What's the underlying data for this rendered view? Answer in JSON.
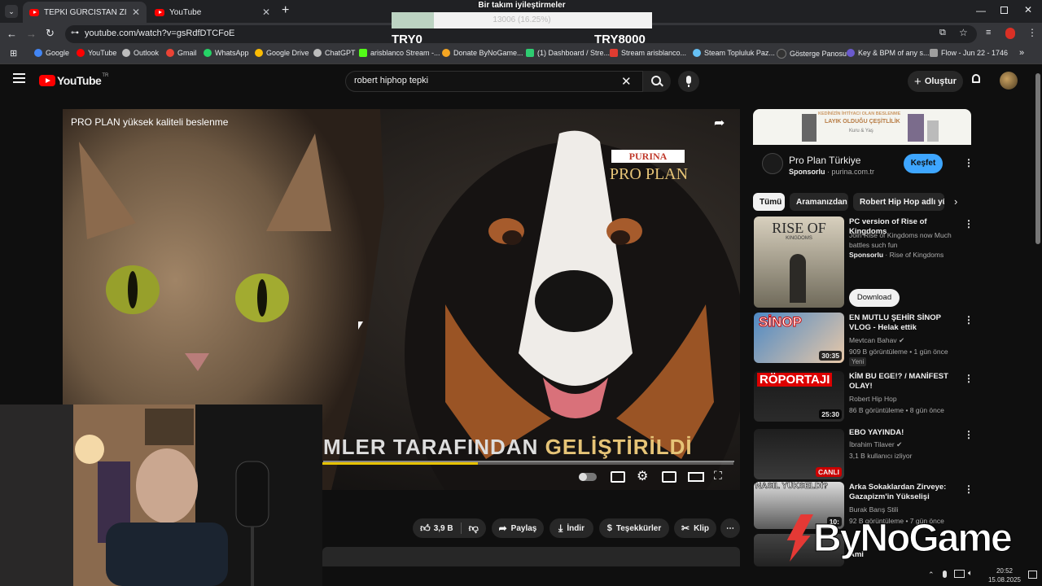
{
  "browser": {
    "tabs": [
      {
        "title": "TEPKİ GÜRCİSTAN ZİYARETİ (yü",
        "active": true
      },
      {
        "title": "YouTube",
        "active": false
      }
    ],
    "new_tab": "+",
    "url": "youtube.com/watch?v=gsRdfDTCFoE",
    "bookmarks": [
      {
        "label": "Google",
        "color": "#4285f4"
      },
      {
        "label": "YouTube",
        "color": "#ff0000"
      },
      {
        "label": "Outlook",
        "color": "#bdbdbd"
      },
      {
        "label": "Gmail",
        "color": "#ea4335"
      },
      {
        "label": "WhatsApp",
        "color": "#25d366"
      },
      {
        "label": "Google Drive",
        "color": "#fbbc04"
      },
      {
        "label": "ChatGPT",
        "color": "#bdbdbd"
      },
      {
        "label": "arisblanco Stream -...",
        "color": "#53fc18"
      },
      {
        "label": "Donate ByNoGame...",
        "color": "#f5a623"
      },
      {
        "label": "(1) Dashboard / Stre...",
        "color": "#2ecc71"
      },
      {
        "label": "Stream arisblanco...",
        "color": "#e03c31"
      },
      {
        "label": "Steam Topluluk Paz...",
        "color": "#66c0f4"
      },
      {
        "label": "Gösterge Panosu",
        "color": "#333333"
      },
      {
        "label": "Key & BPM of any s...",
        "color": "#6a5acd"
      },
      {
        "label": "Flow - Jun 22 - 1746",
        "color": "#9e9e9e"
      }
    ]
  },
  "donation_overlay": {
    "title": "Bir takım iyileştirmeler",
    "progress_text": "13006 (16.25%)",
    "progress_fraction": 0.1625,
    "min_label": "TRY0",
    "max_label": "TRY8000"
  },
  "youtube": {
    "logo": "YouTube",
    "logo_country": "TR",
    "search_query": "robert hiphop tepki",
    "create_label": "Oluştur"
  },
  "player": {
    "ad_title": "PRO PLAN yüksek kaliteli beslenme",
    "brand_top": "PURINA",
    "brand_main": "PRO PLAN",
    "caption_white": "MLER TARAFINDAN ",
    "caption_gold": "GELİŞTİRİLDİ"
  },
  "actions": {
    "likes": "3,9 B",
    "share": "Paylaş",
    "download": "İndir",
    "thanks": "Teşekkürler",
    "clip": "Klip",
    "more": "⋯"
  },
  "sidebar": {
    "ad": {
      "banner_text_1": "KEDİNİZİN İHTİYACI OLAN BESLENME",
      "banner_text_2": "LAYIK OLDUĞU ÇEŞİTLİLİK",
      "banner_text_3": "Kuru & Yaş",
      "advertiser": "Pro Plan Türkiye",
      "sponsored": "Sponsorlu",
      "domain": "purina.com.tr",
      "cta": "Keşfet"
    },
    "chips": [
      "Tümü",
      "Aramanızdan",
      "Robert Hip Hop adlı yük"
    ],
    "sponsored_video": {
      "thumb_title": "RISE OF",
      "thumb_sub": "KINGDOMS",
      "title": "PC version of Rise of Kingdoms",
      "desc": "Join Rise of Kingdoms now Much battles such fun",
      "sponsored": "Sponsorlu",
      "channel": "Rise of Kingdoms",
      "cta": "Download"
    },
    "videos": [
      {
        "title": "EN MUTLU ŞEHİR SİNOP VLOG - Helak ettik",
        "channel": "Mevtcan Bahav",
        "meta": "909 B görüntüleme • 1 gün önce",
        "badge": "Yeni",
        "duration": "30:35",
        "thumb_text": "SİNOP"
      },
      {
        "title": "KİM BU EGE!? / MANİFEST OLAY!",
        "channel": "Robert Hip Hop",
        "meta": "86 B görüntüleme • 8 gün önce",
        "badge": "",
        "duration": "25:30",
        "thumb_text": "RÖPORTAJI"
      },
      {
        "title": "EBO YAYINDA!",
        "channel": "İbrahim Tilaver",
        "meta": "3,1 B kullanıcı izliyor",
        "badge": "",
        "duration": "CANLI",
        "thumb_text": ""
      },
      {
        "title": "Arka Sokaklardan Zirveye: Gazapizm'in Yükselişi",
        "channel": "Burak Barış Stili",
        "meta": "92 B görüntüleme • 7 gün önce",
        "badge": "",
        "duration": "10:",
        "thumb_text": "NASIL YÜKSELDİ?"
      },
      {
        "title": "Ami",
        "channel": "",
        "meta": "",
        "badge": "",
        "duration": "",
        "thumb_text": ""
      }
    ]
  },
  "watermark": "ByNoGame",
  "taskbar": {
    "time": "20:52",
    "date": "15.08.2025"
  }
}
